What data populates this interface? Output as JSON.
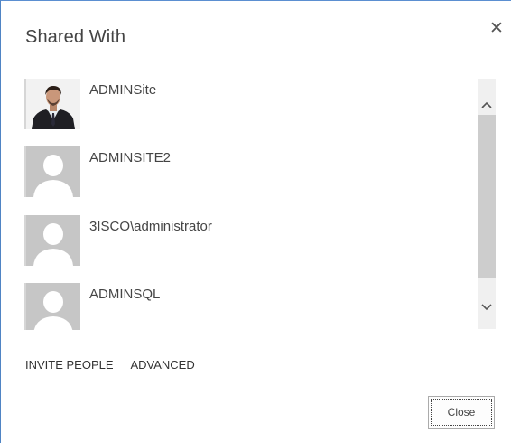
{
  "dialog": {
    "title": "Shared With",
    "close_icon": "close-icon"
  },
  "people": [
    {
      "name": "ADMINSite",
      "avatar": "photo"
    },
    {
      "name": "ADMINSITE2",
      "avatar": "placeholder"
    },
    {
      "name": "3ISCO\\administrator",
      "avatar": "placeholder"
    },
    {
      "name": "ADMINSQL",
      "avatar": "placeholder"
    }
  ],
  "actions": {
    "invite_people": "INVITE PEOPLE",
    "advanced": "ADVANCED"
  },
  "footer": {
    "close_label": "Close"
  },
  "colors": {
    "border_accent": "#4f84c4",
    "placeholder_bg": "#c6c6c6",
    "placeholder_fg": "#ffffff",
    "scroll_thumb": "#cdcdcd",
    "scroll_track": "#f0f0f0"
  }
}
